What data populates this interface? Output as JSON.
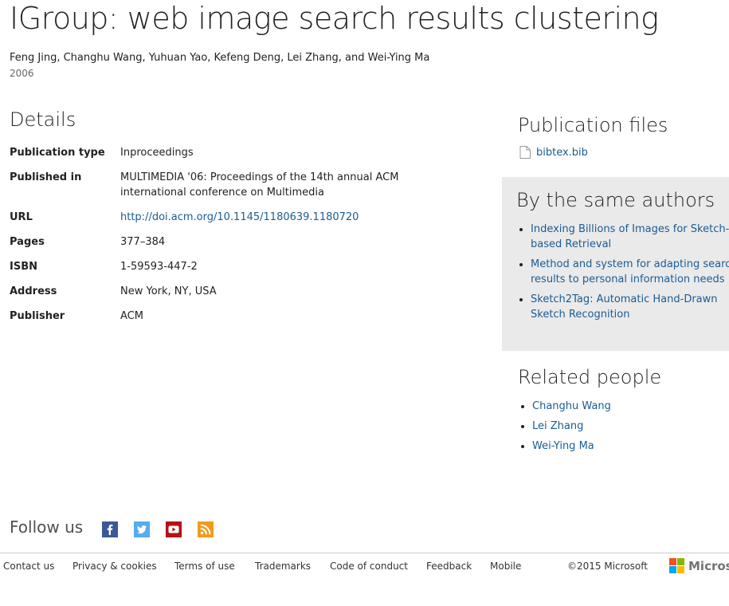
{
  "page": {
    "title": "IGroup: web image search results clustering",
    "authors": "Feng Jing, Changhu Wang, Yuhuan Yao, Kefeng Deng, Lei Zhang, and Wei-Ying Ma",
    "year": "2006"
  },
  "details": {
    "heading": "Details",
    "rows": [
      {
        "label": "Publication type",
        "value": "Inproceedings"
      },
      {
        "label": "Published in",
        "value": "MULTIMEDIA '06: Proceedings of the 14th annual ACM international conference on Multimedia"
      },
      {
        "label": "URL",
        "value": "http://doi.acm.org/10.1145/1180639.1180720"
      },
      {
        "label": "Pages",
        "value": "377–384"
      },
      {
        "label": "ISBN",
        "value": "1-59593-447-2"
      },
      {
        "label": "Address",
        "value": "New York, NY, USA"
      },
      {
        "label": "Publisher",
        "value": "ACM"
      }
    ]
  },
  "publication_files": {
    "heading": "Publication files",
    "files": [
      {
        "name": "bibtex.bib",
        "icon": "document-icon"
      }
    ]
  },
  "same_authors": {
    "heading": "By the same authors",
    "items": [
      "Indexing Billions of Images for Sketch-based Retrieval",
      "Method and system for adapting search results to personal information needs",
      "Sketch2Tag: Automatic Hand-Drawn Sketch Recognition"
    ]
  },
  "related_people": {
    "heading": "Related people",
    "items": [
      "Changhu Wang",
      "Lei Zhang",
      "Wei-Ying Ma"
    ]
  },
  "follow": {
    "label": "Follow us",
    "icons": [
      "facebook-icon",
      "twitter-icon",
      "youtube-icon",
      "rss-icon"
    ]
  },
  "footer": {
    "links": [
      "Contact us",
      "Privacy & cookies",
      "Terms of use",
      "Trademarks",
      "Code of conduct",
      "Feedback",
      "Mobile"
    ],
    "copyright": "©2015 Microsoft",
    "brand": "Microsoft"
  },
  "colors": {
    "link": "#1a5c93",
    "sidebar_bg": "#eaeaea",
    "facebook": "#3b5998",
    "twitter": "#55acee",
    "youtube": "#b31217",
    "rss": "#f29a1d",
    "ms_red": "#f25022",
    "ms_green": "#7fba00",
    "ms_blue": "#00a4ef",
    "ms_yellow": "#ffb900"
  }
}
